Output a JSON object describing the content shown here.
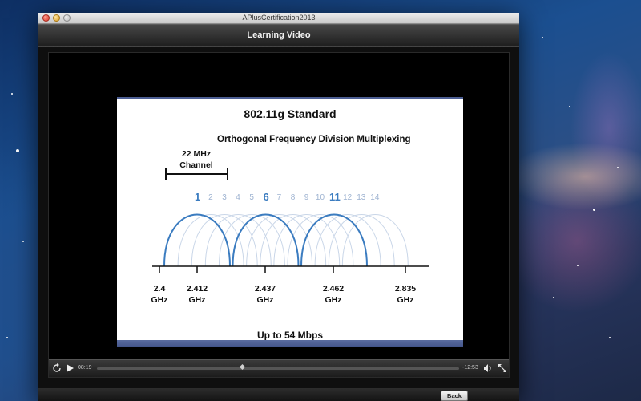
{
  "window": {
    "title": "APlusCertification2013"
  },
  "header": {
    "title": "Learning Video"
  },
  "slide": {
    "title": "802.11g Standard",
    "subtitle": "Orthogonal Frequency Division Multiplexing",
    "channel_label_line1": "22 MHz",
    "channel_label_line2": "Channel",
    "channels": [
      "1",
      "2",
      "3",
      "4",
      "5",
      "6",
      "7",
      "8",
      "9",
      "10",
      "11",
      "12",
      "13",
      "14"
    ],
    "primary_channels": [
      "1",
      "6",
      "11"
    ],
    "frequencies": [
      {
        "value": "2.4",
        "unit": "GHz"
      },
      {
        "value": "2.412",
        "unit": "GHz"
      },
      {
        "value": "2.437",
        "unit": "GHz"
      },
      {
        "value": "2.462",
        "unit": "GHz"
      },
      {
        "value": "2.835",
        "unit": "GHz"
      }
    ],
    "speed": "Up to 54 Mbps",
    "colors": {
      "primary_arc": "#3b7cc0",
      "secondary_arc": "#c9d6e8",
      "bottom_bar": "#4c5e93"
    }
  },
  "controls": {
    "elapsed": "08:19",
    "remaining": "-12:53",
    "progress": 0.4,
    "icons": [
      "replay-icon",
      "play-icon",
      "volume-icon",
      "fullscreen-icon"
    ]
  },
  "footer": {
    "back_label": "Back"
  }
}
